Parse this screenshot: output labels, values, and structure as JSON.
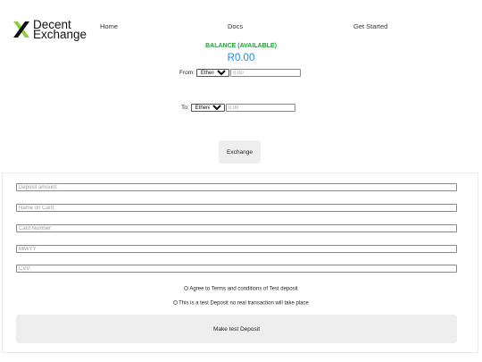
{
  "header": {
    "logo_line1": "Decent",
    "logo_line2": "Exchange",
    "logo_icon": "x-logo-icon",
    "nav": [
      {
        "label": "Home"
      },
      {
        "label": "Docs"
      },
      {
        "label": "Get Started"
      }
    ]
  },
  "balance": {
    "label": "BALANCE (AVAILABLE)",
    "value": "R0.00",
    "label_color": "#23a23a",
    "value_color": "#1e8fd6"
  },
  "exchange": {
    "from": {
      "label": "From:",
      "currency": "Ethereum",
      "placeholder": "0.00"
    },
    "to": {
      "label": "To:",
      "currency": "Ethereum",
      "placeholder": "0.00"
    },
    "button_label": "Exchange"
  },
  "deposit": {
    "fields": [
      {
        "placeholder": "Deposit amount:"
      },
      {
        "placeholder": "Name on Card:"
      },
      {
        "placeholder": "Card Number:"
      },
      {
        "placeholder": "MM/YY"
      },
      {
        "placeholder": "CVV:"
      }
    ],
    "terms_label": "Agree to Terms and conditions of Test deposit",
    "test_notice_label": "This is a test Deposit no real transaction will take place",
    "button_label": "Make test Deposit"
  }
}
